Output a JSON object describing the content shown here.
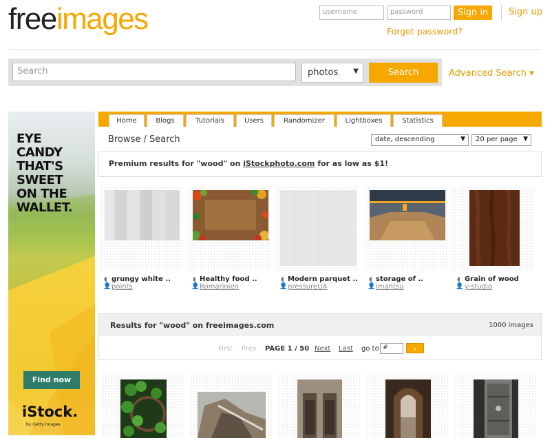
{
  "header": {
    "logo_free": "free",
    "logo_images": "images",
    "username_placeholder": "username",
    "password_placeholder": "password",
    "signin_label": "Sign in",
    "signup_label": "Sign up",
    "forgot_label": "Forgot password?"
  },
  "search": {
    "placeholder": "Search",
    "category_value": "photos",
    "button_label": "Search",
    "advanced_label": "Advanced Search ▾"
  },
  "ad": {
    "headline_lines": [
      "EYE",
      "CANDY",
      "THAT'S",
      "SWEET",
      "ON THE",
      "WALLET."
    ],
    "cta_label": "Find now",
    "brand": "iStock.",
    "brand_sub": "by Getty Images"
  },
  "tabs": [
    "Home",
    "Blogs",
    "Tutorials",
    "Users",
    "Randomizer",
    "Lightboxes",
    "Statistics"
  ],
  "browse": {
    "title": "Browse / Search",
    "sort_value": "date, descending",
    "per_page_value": "20 per page"
  },
  "premium": {
    "text_before": "Premium results for \"wood\" on ",
    "link": "iStockphoto.com",
    "text_after": " for as low as $1!"
  },
  "premium_results": [
    {
      "title": "grungy white ..",
      "user": "points"
    },
    {
      "title": "Healthy food ..",
      "user": "RomarioIen"
    },
    {
      "title": "Modern parquet ..",
      "user": "pressureUA"
    },
    {
      "title": "storage of ..",
      "user": "imantsu"
    },
    {
      "title": "Grain of wood",
      "user": "y-studio"
    }
  ],
  "results": {
    "title": "Results for \"wood\" on freeimages.com",
    "count": "1000 images",
    "first": "First",
    "prev": "Prev",
    "page_indicator": "PAGE 1 / 50",
    "next": "Next",
    "last": "Last",
    "goto_label": "go to",
    "goto_value": "#"
  },
  "colors": {
    "accent": "#f6a800",
    "link": "#e59a00"
  }
}
